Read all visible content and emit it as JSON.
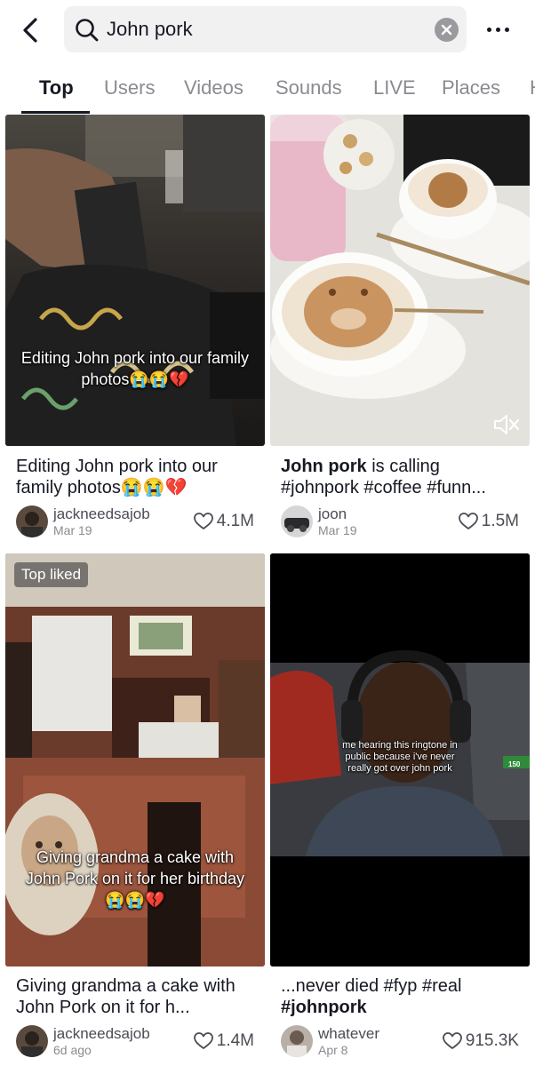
{
  "search": {
    "query": "John pork"
  },
  "tabs": [
    "Top",
    "Users",
    "Videos",
    "Sounds",
    "LIVE",
    "Places",
    "H"
  ],
  "cards": [
    {
      "overlay_text": "Editing John pork into our family photos😭😭💔",
      "title": "Editing John pork into our family photos😭😭💔",
      "author": "jackneedsajob",
      "date": "Mar 19",
      "likes": "4.1M"
    },
    {
      "title_bold": "John pork",
      "title_rest": " is calling #johnpork #coffee #funn...",
      "author": "joon",
      "date": "Mar 19",
      "likes": "1.5M"
    },
    {
      "badge": "Top liked",
      "overlay_text": "Giving grandma a cake with John Pork on it for her birthday😭😭💔",
      "title": "Giving grandma a cake with John Pork on it for h...",
      "author": "jackneedsajob",
      "date": "6d ago",
      "likes": "1.4M"
    },
    {
      "overlay_text": "me hearing this ringtone in public because i've never really got over john pork",
      "side_number": "150",
      "title_rest": "...never died #fyp #real ",
      "title_bold": "#johnpork",
      "author": "whatever",
      "date": "Apr 8",
      "likes": "915.3K"
    }
  ]
}
